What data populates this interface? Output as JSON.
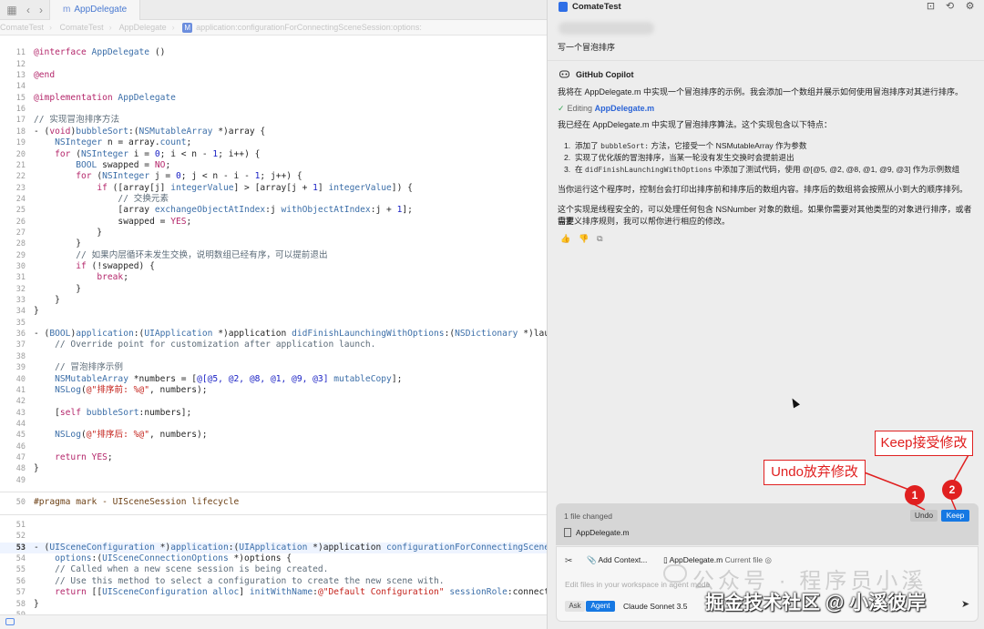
{
  "editor": {
    "tab_label": "AppDelegate",
    "jumpbar": [
      "ComateTest",
      "ComateTest",
      "AppDelegate",
      "application:configurationForConnectingSceneSession:options:"
    ],
    "lines": [
      {
        "n": "",
        "html": ""
      },
      {
        "n": "11",
        "html": "<span class=\"kw\">@interface</span> <span class=\"ty\">AppDelegate</span> ()"
      },
      {
        "n": "12",
        "html": ""
      },
      {
        "n": "13",
        "html": "<span class=\"kw\">@end</span>"
      },
      {
        "n": "14",
        "html": ""
      },
      {
        "n": "15",
        "html": "<span class=\"kw\">@implementation</span> <span class=\"ty\">AppDelegate</span>"
      },
      {
        "n": "16",
        "html": ""
      },
      {
        "n": "17",
        "html": "<span class=\"cm\">// 实现冒泡排序方法</span>"
      },
      {
        "n": "18",
        "html": "- (<span class=\"kw\">void</span>)<span class=\"fn\">bubbleSort</span>:(<span class=\"ty\">NSMutableArray</span> *)array {"
      },
      {
        "n": "19",
        "html": "    <span class=\"ty\">NSInteger</span> n = array.<span class=\"pr\">count</span>;"
      },
      {
        "n": "20",
        "html": "    <span class=\"kw\">for</span> (<span class=\"ty\">NSInteger</span> i = <span class=\"num\">0</span>; i &lt; n - <span class=\"num\">1</span>; i++) {"
      },
      {
        "n": "21",
        "html": "        <span class=\"ty\">BOOL</span> swapped = <span class=\"kw\">NO</span>;"
      },
      {
        "n": "22",
        "html": "        <span class=\"kw\">for</span> (<span class=\"ty\">NSInteger</span> j = <span class=\"num\">0</span>; j &lt; n - i - <span class=\"num\">1</span>; j++) {"
      },
      {
        "n": "23",
        "html": "            <span class=\"kw\">if</span> ([array[j] <span class=\"pr\">integerValue</span>] &gt; [array[j + <span class=\"num\">1</span>] <span class=\"pr\">integerValue</span>]) {"
      },
      {
        "n": "24",
        "html": "                <span class=\"cm\">// 交换元素</span>"
      },
      {
        "n": "25",
        "html": "                [array <span class=\"pr\">exchangeObjectAtIndex</span>:j <span class=\"pr\">withObjectAtIndex</span>:j + <span class=\"num\">1</span>];"
      },
      {
        "n": "26",
        "html": "                swapped = <span class=\"kw\">YES</span>;"
      },
      {
        "n": "27",
        "html": "            }"
      },
      {
        "n": "28",
        "html": "        }"
      },
      {
        "n": "29",
        "html": "        <span class=\"cm\">// 如果内层循环未发生交换，说明数组已经有序，可以提前退出</span>"
      },
      {
        "n": "30",
        "html": "        <span class=\"kw\">if</span> (!swapped) {"
      },
      {
        "n": "31",
        "html": "            <span class=\"kw\">break</span>;"
      },
      {
        "n": "32",
        "html": "        }"
      },
      {
        "n": "33",
        "html": "    }"
      },
      {
        "n": "34",
        "html": "}"
      },
      {
        "n": "35",
        "html": ""
      },
      {
        "n": "36",
        "html": "- (<span class=\"ty\">BOOL</span>)<span class=\"fn\">application</span>:(<span class=\"ty\">UIApplication</span> *)application <span class=\"fn\">didFinishLaunchingWithOptions</span>:(<span class=\"ty\">NSDictionary</span> *)launchOp"
      },
      {
        "n": "37",
        "html": "    <span class=\"cm\">// Override point for customization after application launch.</span>"
      },
      {
        "n": "38",
        "html": ""
      },
      {
        "n": "39",
        "html": "    <span class=\"cm\">// 冒泡排序示例</span>"
      },
      {
        "n": "40",
        "html": "    <span class=\"ty\">NSMutableArray</span> *numbers = [<span class=\"num\">@[@5, @2, @8, @1, @9, @3]</span> <span class=\"pr\">mutableCopy</span>];"
      },
      {
        "n": "41",
        "html": "    <span class=\"fn\">NSLog</span>(<span class=\"str\">@\"排序前: %@\"</span>, numbers);"
      },
      {
        "n": "42",
        "html": ""
      },
      {
        "n": "43",
        "html": "    [<span class=\"kw\">self</span> <span class=\"pr\">bubbleSort</span>:numbers];"
      },
      {
        "n": "44",
        "html": ""
      },
      {
        "n": "45",
        "html": "    <span class=\"fn\">NSLog</span>(<span class=\"str\">@\"排序后: %@\"</span>, numbers);"
      },
      {
        "n": "46",
        "html": ""
      },
      {
        "n": "47",
        "html": "    <span class=\"kw\">return</span> <span class=\"kw\">YES</span>;"
      },
      {
        "n": "48",
        "html": "}"
      },
      {
        "n": "49",
        "html": ""
      },
      {
        "n": "",
        "html": ""
      },
      {
        "n": "50",
        "html": "<span class=\"pre\">#pragma mark - UISceneSession lifecycle</span>"
      },
      {
        "n": "",
        "html": ""
      },
      {
        "n": "51",
        "html": ""
      },
      {
        "n": "52",
        "html": ""
      },
      {
        "n": "53",
        "html": "- (<span class=\"ty\">UISceneConfiguration</span> *)<span class=\"fn\">application</span>:(<span class=\"ty\">UIApplication</span> *)application <span class=\"fn\">configurationForConnectingSceneSessi</span>",
        "active": true
      },
      {
        "n": "54",
        "html": "    <span class=\"fn\">options</span>:(<span class=\"ty\">UISceneConnectionOptions</span> *)options {"
      },
      {
        "n": "55",
        "html": "    <span class=\"cm\">// Called when a new scene session is being created.</span>"
      },
      {
        "n": "56",
        "html": "    <span class=\"cm\">// Use this method to select a configuration to create the new scene with.</span>"
      },
      {
        "n": "57",
        "html": "    <span class=\"kw\">return</span> [[<span class=\"ty\">UISceneConfiguration</span> <span class=\"pr\">alloc</span>] <span class=\"pr\">initWithName</span>:<span class=\"str\">@\"Default Configuration\"</span> <span class=\"pr\">sessionRole</span>:connectingSc"
      },
      {
        "n": "58",
        "html": "}"
      },
      {
        "n": "59",
        "html": ""
      },
      {
        "n": "60",
        "html": ""
      }
    ]
  },
  "chat": {
    "title": "ComateTest",
    "user_message": "写一个冒泡排序",
    "assistant_name": "GitHub Copilot",
    "intro": "我将在 AppDelegate.m 中实现一个冒泡排序的示例。我会添加一个数组并展示如何使用冒泡排序对其进行排序。",
    "editing_label": "Editing",
    "editing_file": "AppDelegate.m",
    "done_text": "我已经在 AppDelegate.m 中实现了冒泡排序算法。这个实现包含以下特点：",
    "list": [
      {
        "num": "1.",
        "pre": "添加了 ",
        "code": "bubbleSort:",
        "post": " 方法，它接受一个 NSMutableArray 作为参数"
      },
      {
        "num": "2.",
        "pre": "实现了优化版的冒泡排序，当某一轮没有发生交换时会提前退出",
        "code": "",
        "post": ""
      },
      {
        "num": "3.",
        "pre": "在 ",
        "code": "didFinishLaunchingWithOptions",
        "post": " 中添加了测试代码，使用 @[@5, @2, @8, @1, @9, @3] 作为示例数组"
      }
    ],
    "para_run": "当你运行这个程序时，控制台会打印出排序前和排序后的数组内容。排序后的数组将会按照从小到大的顺序排列。",
    "para_safe_1": "这个实现是线程安全的，可以处理任何包含 NSNumber 对象的数组。如果你需要对其他类型的对象进行排序，或者需要",
    "para_safe_2": "自定义排序规则，我可以帮你进行相应的修改。",
    "changes": {
      "summary": "1 file changed",
      "file": "AppDelegate.m",
      "undo_label": "Undo",
      "keep_label": "Keep"
    },
    "input": {
      "add_context_label": "Add Context...",
      "current_file_name": "AppDelegate.m",
      "current_file_note": "Current file",
      "placeholder": "Edit files in your workspace in agent mode",
      "mode_ask": "Ask",
      "mode_agent": "Agent",
      "model": "Claude Sonnet 3.5"
    }
  },
  "annotations": {
    "undo_text": "Undo放弃修改",
    "keep_text": "Keep接受修改",
    "marker_1": "1",
    "marker_2": "2",
    "color": "#e02020"
  },
  "watermark": {
    "line1": "公众号 · 程序员小溪",
    "line2": "掘金技术社区 @ 小溪彼岸"
  }
}
